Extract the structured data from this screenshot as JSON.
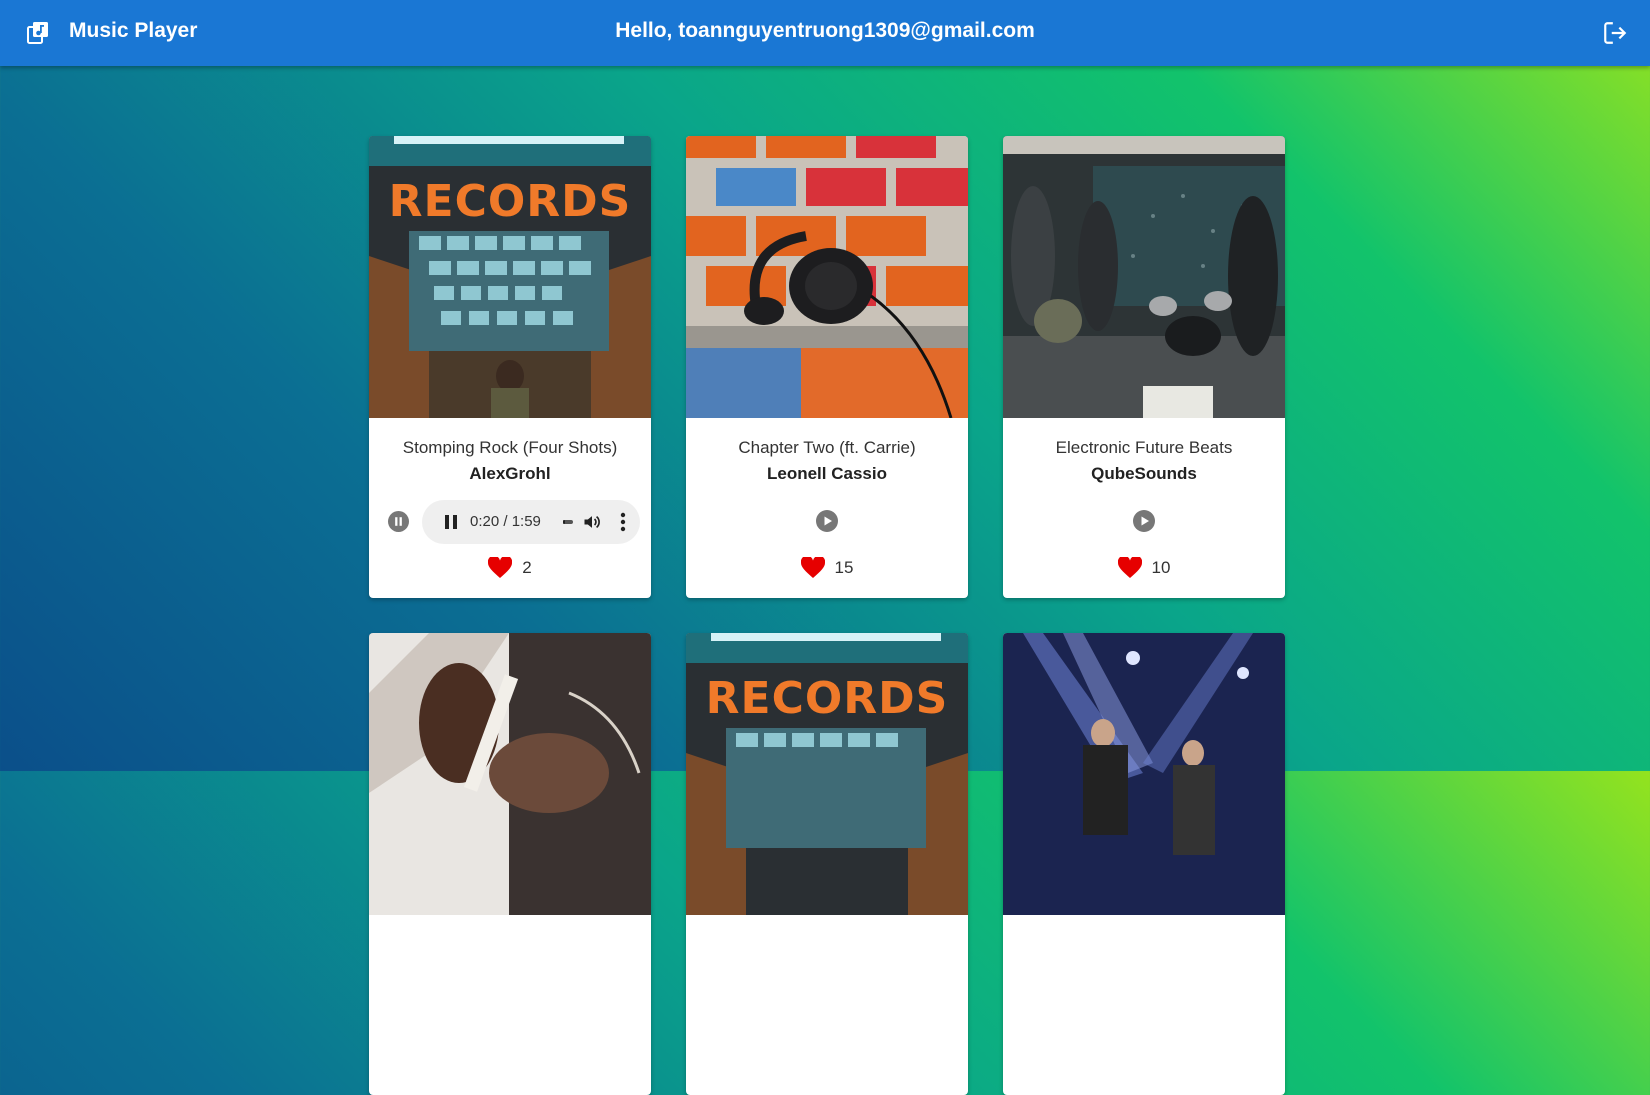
{
  "header": {
    "title": "Music Player",
    "greeting": "Hello, toannguyentruong1309@gmail.com",
    "logo_icon": "library-music-icon",
    "logout_icon": "logout-icon",
    "bar_color": "#1a77d4"
  },
  "songs": [
    {
      "title": "Stomping Rock (Four Shots)",
      "artist": "AlexGrohl",
      "likes": "2",
      "playing": true,
      "cover": "records-store"
    },
    {
      "title": "Chapter Two (ft. Carrie)",
      "artist": "Leonell Cassio",
      "likes": "15",
      "playing": false,
      "cover": "headphones-brick-wall"
    },
    {
      "title": "Electronic Future Beats",
      "artist": "QubeSounds",
      "likes": "10",
      "playing": false,
      "cover": "band-rehearsal"
    },
    {
      "cover": "guitar-closeup"
    },
    {
      "cover": "records-store"
    },
    {
      "cover": "concert-stage-lights"
    }
  ],
  "player": {
    "time": "0:20 / 1:59",
    "progress_fraction": 0.17
  },
  "colors": {
    "heart": "#e60000",
    "accent": "#1a77d4"
  }
}
